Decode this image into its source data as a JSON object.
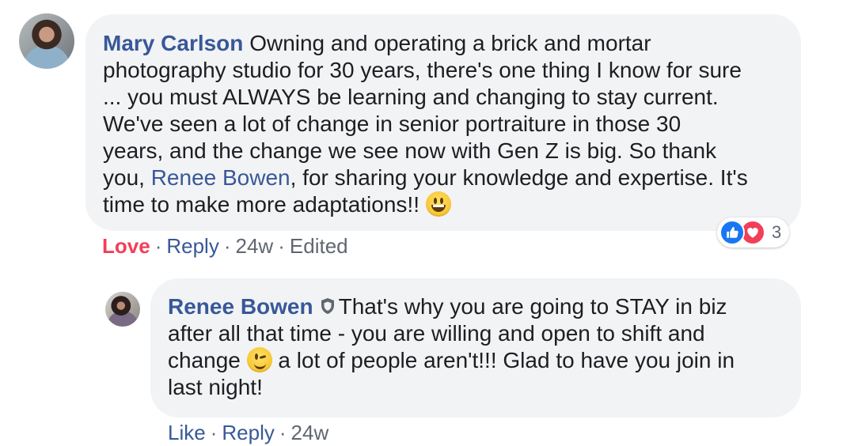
{
  "comment": {
    "author": "Mary Carlson",
    "lines": [
      "Owning and operating a brick and mortar",
      "photography studio for 30 years, there's one thing I know for sure",
      "... you must ALWAYS be learning and changing to stay current.",
      "We've seen a lot of change in senior portraiture in those 30",
      "years, and the change we see now with Gen Z is big. So thank",
      "you, ",
      "Renee Bowen",
      ", for sharing your knowledge and expertise. It's",
      "time to make more adaptations!! "
    ],
    "emoji": "grinning-face",
    "actions": {
      "love": "Love",
      "reply": "Reply",
      "time": "24w",
      "edited": "Edited",
      "separator": "·"
    },
    "reactions": {
      "count": "3",
      "types": [
        "like",
        "love"
      ]
    }
  },
  "reply": {
    "author": "Renee Bowen",
    "badge": "shield-icon",
    "lines": [
      "That's why you are going to STAY in biz",
      "after all that time - you are willing and open to shift and",
      "change ",
      " a lot of people aren't!!! Glad to have you join in",
      "last night!"
    ],
    "emoji": "winking-face",
    "actions": {
      "like": "Like",
      "reply": "Reply",
      "time": "24w",
      "separator": "·"
    }
  },
  "colors": {
    "name_blue": "#385898",
    "love_red": "#f33e58",
    "like_blue": "#1877f2",
    "bubble_bg": "#f2f3f5",
    "meta_gray": "#606770"
  }
}
